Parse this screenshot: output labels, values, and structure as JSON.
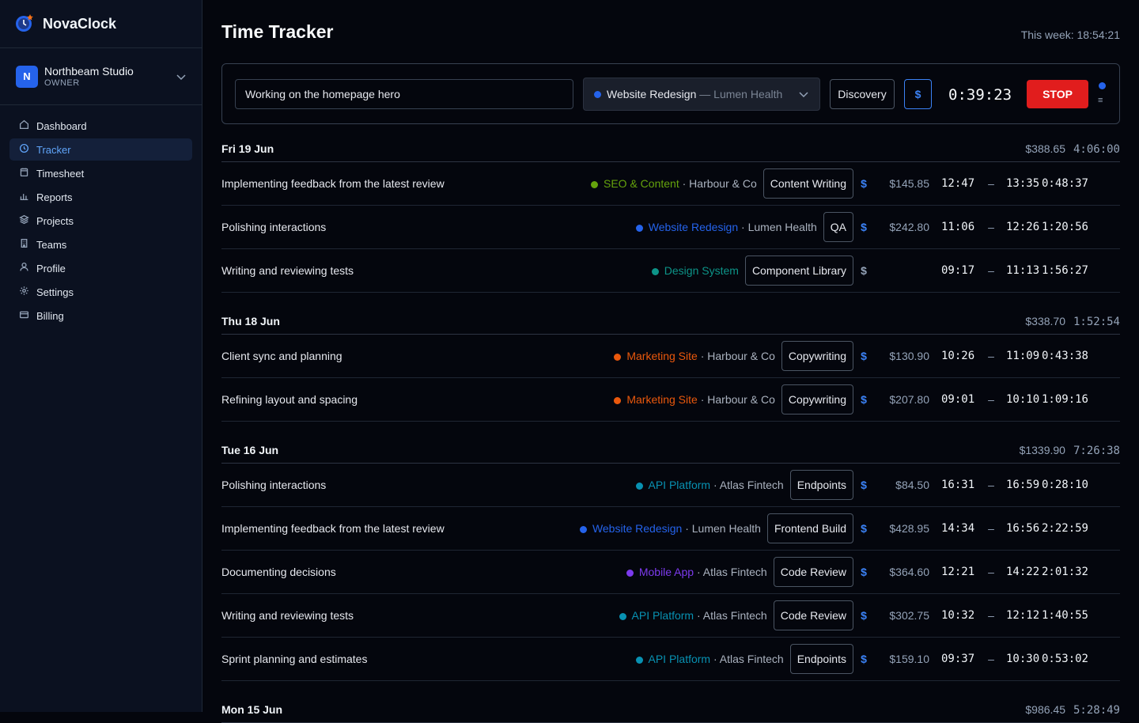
{
  "app": {
    "name": "NovaClock"
  },
  "org": {
    "initial": "N",
    "name": "Northbeam Studio",
    "role": "OWNER"
  },
  "nav": [
    {
      "label": "Dashboard",
      "icon": "home-icon"
    },
    {
      "label": "Tracker",
      "icon": "clock-icon",
      "active": true
    },
    {
      "label": "Timesheet",
      "icon": "calendar-icon"
    },
    {
      "label": "Reports",
      "icon": "bar-chart-icon"
    },
    {
      "label": "Projects",
      "icon": "layers-icon"
    },
    {
      "label": "Teams",
      "icon": "building-icon"
    },
    {
      "label": "Profile",
      "icon": "user-icon"
    },
    {
      "label": "Settings",
      "icon": "gear-icon"
    },
    {
      "label": "Billing",
      "icon": "credit-card-icon"
    }
  ],
  "header": {
    "title": "Time Tracker",
    "weekly": "This week: 18:54:21"
  },
  "timer": {
    "description": "Working on the homepage hero",
    "project": "Website Redesign",
    "client": "Lumen Health",
    "project_color": "#2563eb",
    "tag": "Discovery",
    "billable_symbol": "$",
    "elapsed": "0:39:23",
    "stop_label": "STOP",
    "mode_icon": "≡"
  },
  "days": [
    {
      "label": "Fri 19 Jun",
      "amount": "$388.65",
      "duration": "4:06:00",
      "entries": [
        {
          "desc": "Implementing feedback from the latest review",
          "project": "SEO & Content",
          "color": "#65a30d",
          "client": "Harbour & Co",
          "tag": "Content Writing",
          "billable": true,
          "amount": "$145.85",
          "start": "12:47",
          "end": "13:35",
          "duration": "0:48:37"
        },
        {
          "desc": "Polishing interactions",
          "project": "Website Redesign",
          "color": "#2563eb",
          "client": "Lumen Health",
          "tag": "QA",
          "billable": true,
          "amount": "$242.80",
          "start": "11:06",
          "end": "12:26",
          "duration": "1:20:56"
        },
        {
          "desc": "Writing and reviewing tests",
          "project": "Design System",
          "color": "#0d9488",
          "client": "",
          "tag": "Component Library",
          "billable": false,
          "amount": "",
          "start": "09:17",
          "end": "11:13",
          "duration": "1:56:27"
        }
      ]
    },
    {
      "label": "Thu 18 Jun",
      "amount": "$338.70",
      "duration": "1:52:54",
      "entries": [
        {
          "desc": "Client sync and planning",
          "project": "Marketing Site",
          "color": "#ea580c",
          "client": "Harbour & Co",
          "tag": "Copywriting",
          "billable": true,
          "amount": "$130.90",
          "start": "10:26",
          "end": "11:09",
          "duration": "0:43:38"
        },
        {
          "desc": "Refining layout and spacing",
          "project": "Marketing Site",
          "color": "#ea580c",
          "client": "Harbour & Co",
          "tag": "Copywriting",
          "billable": true,
          "amount": "$207.80",
          "start": "09:01",
          "end": "10:10",
          "duration": "1:09:16"
        }
      ]
    },
    {
      "label": "Tue 16 Jun",
      "amount": "$1339.90",
      "duration": "7:26:38",
      "entries": [
        {
          "desc": "Polishing interactions",
          "project": "API Platform",
          "color": "#0891b2",
          "client": "Atlas Fintech",
          "tag": "Endpoints",
          "billable": true,
          "amount": "$84.50",
          "start": "16:31",
          "end": "16:59",
          "duration": "0:28:10"
        },
        {
          "desc": "Implementing feedback from the latest review",
          "project": "Website Redesign",
          "color": "#2563eb",
          "client": "Lumen Health",
          "tag": "Frontend Build",
          "billable": true,
          "amount": "$428.95",
          "start": "14:34",
          "end": "16:56",
          "duration": "2:22:59"
        },
        {
          "desc": "Documenting decisions",
          "project": "Mobile App",
          "color": "#7c3aed",
          "client": "Atlas Fintech",
          "tag": "Code Review",
          "billable": true,
          "amount": "$364.60",
          "start": "12:21",
          "end": "14:22",
          "duration": "2:01:32"
        },
        {
          "desc": "Writing and reviewing tests",
          "project": "API Platform",
          "color": "#0891b2",
          "client": "Atlas Fintech",
          "tag": "Code Review",
          "billable": true,
          "amount": "$302.75",
          "start": "10:32",
          "end": "12:12",
          "duration": "1:40:55"
        },
        {
          "desc": "Sprint planning and estimates",
          "project": "API Platform",
          "color": "#0891b2",
          "client": "Atlas Fintech",
          "tag": "Endpoints",
          "billable": true,
          "amount": "$159.10",
          "start": "09:37",
          "end": "10:30",
          "duration": "0:53:02"
        }
      ]
    },
    {
      "label": "Mon 15 Jun",
      "amount": "$986.45",
      "duration": "5:28:49",
      "entries": []
    }
  ],
  "range_dash": "–",
  "sep": "·",
  "em_dash": "—"
}
